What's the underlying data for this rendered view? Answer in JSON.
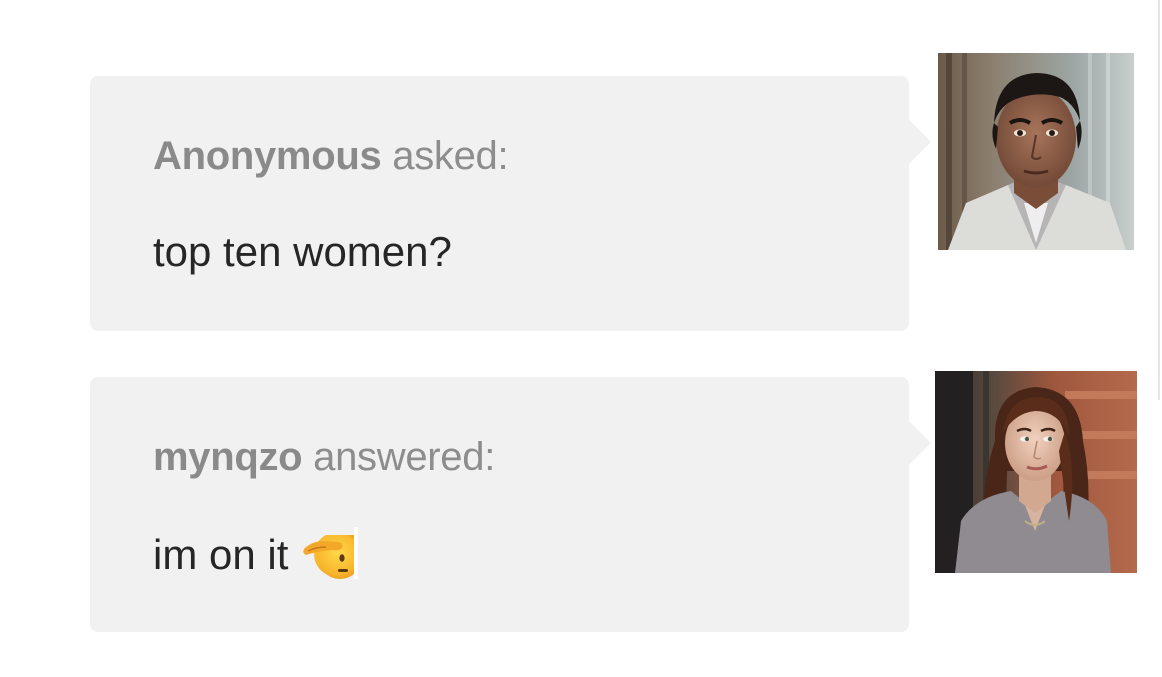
{
  "question": {
    "author": "Anonymous",
    "verb": "asked:",
    "text": "top ten women?"
  },
  "answer": {
    "author": "mynqzo",
    "verb": "answered:",
    "text": "im on it",
    "emoji": "saluting-face-emoji"
  },
  "avatars": {
    "asker": "man-in-white-coat-avatar",
    "answerer": "woman-with-long-brown-hair-avatar"
  }
}
